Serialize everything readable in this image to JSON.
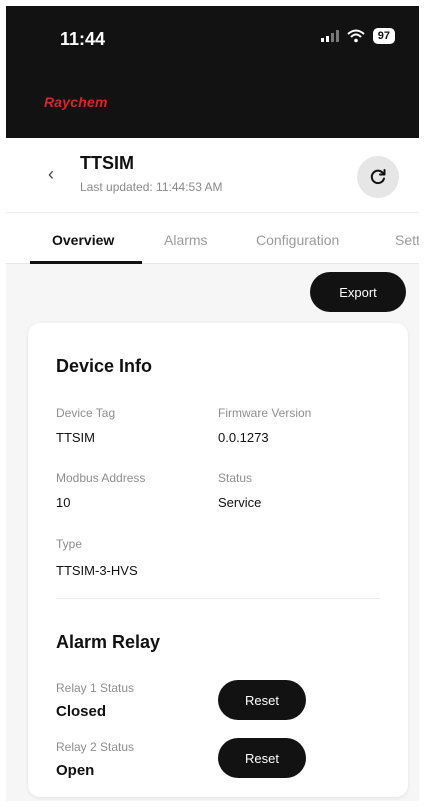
{
  "status_bar": {
    "time": "11:44",
    "battery": "97",
    "icons": [
      "cellular-signal-icon",
      "wifi-icon",
      "battery-icon"
    ]
  },
  "brand": {
    "name": "Raychem",
    "color": "#d8242a"
  },
  "header": {
    "back_icon": "chevron-left-icon",
    "title": "TTSIM",
    "last_updated": "Last updated: 11:44:53 AM",
    "refresh_icon": "refresh-icon"
  },
  "tabs": [
    {
      "label": "Overview",
      "active": true
    },
    {
      "label": "Alarms",
      "active": false
    },
    {
      "label": "Configuration",
      "active": false
    },
    {
      "label": "Setti",
      "active": false
    }
  ],
  "actions": {
    "export_label": "Export"
  },
  "device_info": {
    "title": "Device Info",
    "fields": [
      {
        "label": "Device Tag",
        "value": "TTSIM"
      },
      {
        "label": "Firmware Version",
        "value": "0.0.1273"
      },
      {
        "label": "Modbus Address",
        "value": "10"
      },
      {
        "label": "Status",
        "value": "Service"
      },
      {
        "label": "Type",
        "value": "TTSIM-3-HVS"
      }
    ]
  },
  "alarm_relay": {
    "title": "Alarm Relay",
    "relays": [
      {
        "label": "Relay 1 Status",
        "value": "Closed",
        "button": "Reset"
      },
      {
        "label": "Relay 2 Status",
        "value": "Open",
        "button": "Reset"
      }
    ]
  },
  "colors": {
    "dark": "#121212",
    "accent": "#d8242a",
    "muted": "#8e8e8e"
  }
}
